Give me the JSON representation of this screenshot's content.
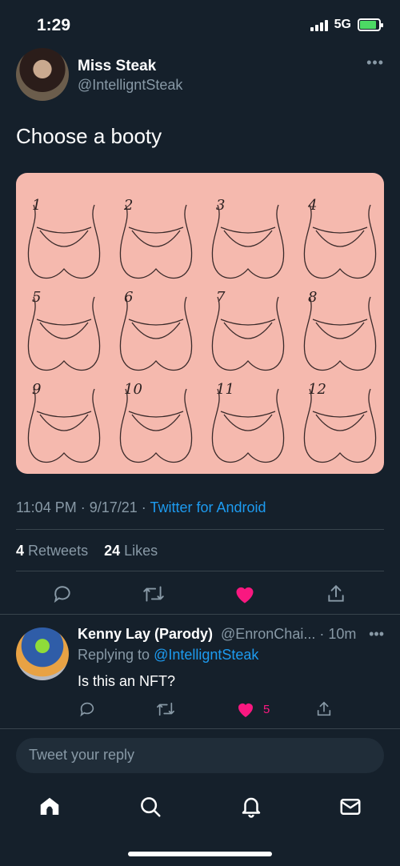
{
  "status_bar": {
    "time": "1:29",
    "network": "5G",
    "battery_color": "#4cd964"
  },
  "tweet": {
    "author_name": "Miss Steak",
    "author_handle": "@IntelligntSteak",
    "text": "Choose a booty",
    "image": {
      "labels": [
        "1",
        "2",
        "3",
        "4",
        "5",
        "6",
        "7",
        "8",
        "9",
        "10",
        "11",
        "12"
      ],
      "background": "#f5b9ae"
    },
    "timestamp": "11:04 PM · 9/17/21 · ",
    "source": "Twitter for Android",
    "retweets_count": "4",
    "retweets_label": "Retweets",
    "likes_count": "24",
    "likes_label": "Likes",
    "liked": true
  },
  "reply": {
    "author_name": "Kenny Lay (Parody)",
    "author_handle": "@EnronChai... · 10m",
    "replying_prefix": "Replying to ",
    "replying_to": "@IntelligntSteak",
    "text": "Is this an NFT?",
    "like_count": "5",
    "liked": true
  },
  "compose": {
    "placeholder": "Tweet your reply"
  },
  "tab_bar": {
    "items": [
      "home-icon",
      "search-icon",
      "bell-icon",
      "mail-icon"
    ]
  },
  "colors": {
    "background": "#15202b",
    "accent": "#1d9bf0",
    "like": "#f91880",
    "muted": "#8899a6"
  }
}
